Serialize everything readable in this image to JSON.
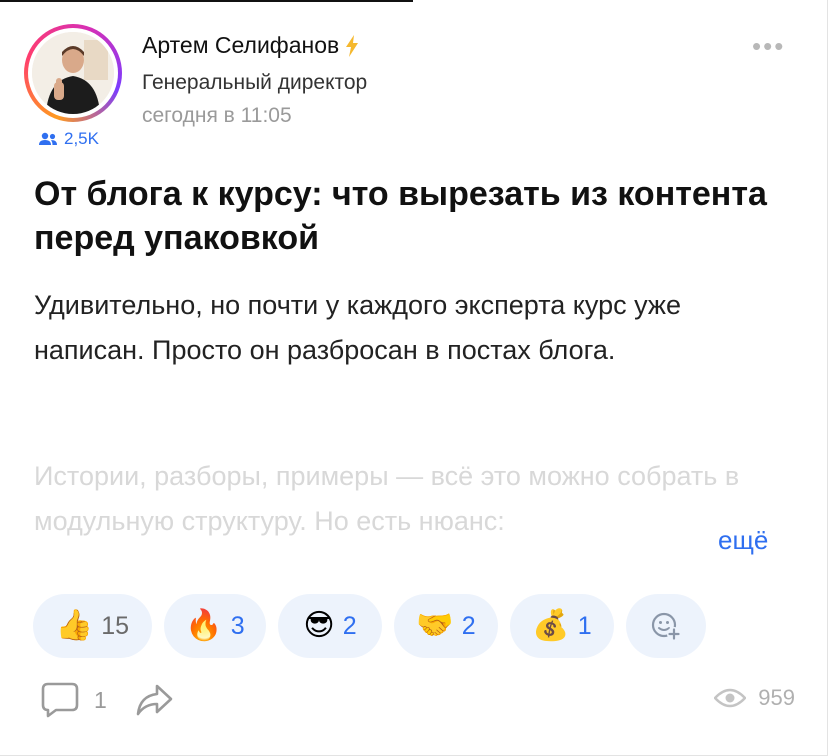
{
  "author": {
    "name": "Артем Селифанов",
    "role": "Генеральный директор",
    "time": "сегодня в 11:05",
    "followers": "2,5K"
  },
  "menu_icon": "more-dots-icon",
  "post": {
    "title": "От блога к курсу: что вырезать из контента перед упаковкой",
    "body": "Удивительно, но почти у каждого эксперта курс уже написан. Просто он разбросан в постах блога.",
    "faded": "Истории, разборы, примеры — всё это можно собрать в модульную структуру. Но есть нюанс:",
    "more": "ещё"
  },
  "reactions": [
    {
      "icon": "thumbs-up-icon",
      "count": "15"
    },
    {
      "icon": "fire-icon",
      "count": "3"
    },
    {
      "icon": "cool-face-icon",
      "count": "2"
    },
    {
      "icon": "handshake-icon",
      "count": "2"
    },
    {
      "icon": "money-bag-icon",
      "count": "1"
    }
  ],
  "footer": {
    "comments": "1",
    "views": "959"
  },
  "colors": {
    "accent": "#2f6ff0",
    "reaction_bg": "#edf3fc",
    "muted": "#9a9a9a",
    "lightning": "#f5b82e"
  }
}
